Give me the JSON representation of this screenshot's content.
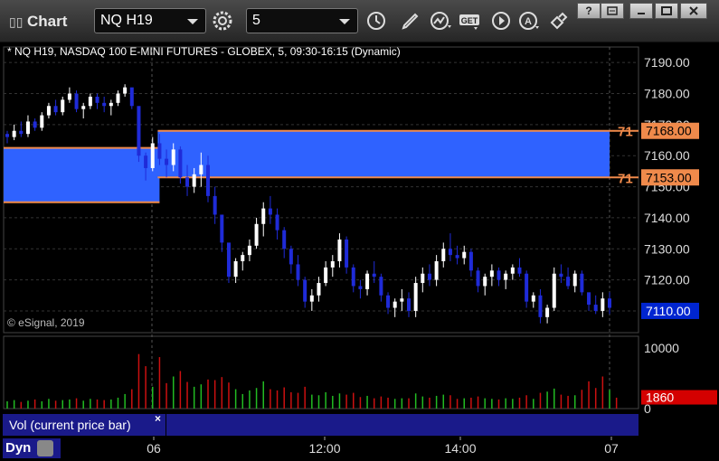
{
  "toolbar": {
    "title": "Chart",
    "symbol": "NQ H19",
    "interval": "5",
    "icons": [
      "settings-icon",
      "clock-icon",
      "pencil-icon",
      "studies-icon",
      "get-icon",
      "play-icon",
      "alert-icon",
      "link-icon"
    ],
    "window_buttons": [
      "help-icon",
      "restore-icon",
      "minimize-icon",
      "maximize-icon",
      "close-icon"
    ]
  },
  "chart_info": {
    "description": "* NQ H19, NASDAQ 100 E-MINI FUTURES - GLOBEX, 5, 09:30-16:15 (Dynamic)",
    "copyright": "© eSignal, 2019"
  },
  "price_axis": {
    "ticks": [
      "7190.00",
      "7180.00",
      "7170.00",
      "7160.00",
      "7150.00",
      "7140.00",
      "7130.00",
      "7120.00",
      "7110.00"
    ],
    "last_price": "7110.00",
    "upper_line_label": "7168.00",
    "lower_line_label": "7153.00",
    "upper_line_tag": "71",
    "lower_line_tag": "71"
  },
  "volume_axis": {
    "ticks": [
      "10000",
      "0"
    ],
    "last_volume": "1860"
  },
  "time_axis": {
    "ticks": [
      "06",
      "12:00",
      "14:00",
      "07"
    ]
  },
  "volume_panel": {
    "label": "Vol (current price bar)",
    "close": "×"
  },
  "footer": {
    "dyn_label": "Dyn"
  },
  "colors": {
    "up_candle": "#ffffff",
    "down_candle": "#1f2bd8",
    "zone_fill": "#2f62ff",
    "zone_border": "#f08a4b",
    "price_tag_blue": "#0025d0",
    "volume_tag_red": "#d40000",
    "volume_up": "#22bb22",
    "volume_down": "#cc1010"
  },
  "chart_data": {
    "type": "candlestick",
    "symbol": "NQ H19",
    "interval": "5",
    "ylim": [
      7103,
      7195
    ],
    "volume_ylim": [
      0,
      10000
    ],
    "zones": [
      {
        "top": 7162.5,
        "bottom": 7145.0,
        "from_bar": 0,
        "to_bar": 22
      },
      {
        "top": 7168.0,
        "bottom": 7153.0,
        "from_bar": 22,
        "to_bar": 96
      }
    ],
    "candles": [
      [
        7167,
        7168,
        7164,
        7166
      ],
      [
        7166,
        7170,
        7165,
        7168
      ],
      [
        7168,
        7171,
        7166,
        7167
      ],
      [
        7167,
        7173,
        7166,
        7171
      ],
      [
        7171,
        7172,
        7168,
        7169
      ],
      [
        7169,
        7174,
        7168,
        7173
      ],
      [
        7173,
        7177,
        7172,
        7176
      ],
      [
        7176,
        7178,
        7173,
        7174
      ],
      [
        7174,
        7179,
        7173,
        7178
      ],
      [
        7178,
        7182,
        7177,
        7180
      ],
      [
        7180,
        7181,
        7174,
        7175
      ],
      [
        7175,
        7177,
        7172,
        7176
      ],
      [
        7176,
        7180,
        7175,
        7179
      ],
      [
        7179,
        7180,
        7175,
        7177
      ],
      [
        7177,
        7179,
        7174,
        7176
      ],
      [
        7176,
        7178,
        7173,
        7177
      ],
      [
        7177,
        7181,
        7176,
        7180
      ],
      [
        7180,
        7183,
        7179,
        7182
      ],
      [
        7182,
        7181,
        7175,
        7176
      ],
      [
        7176,
        7175,
        7158,
        7160
      ],
      [
        7160,
        7161,
        7152,
        7156
      ],
      [
        7156,
        7166,
        7155,
        7164
      ],
      [
        7164,
        7167,
        7157,
        7159
      ],
      [
        7159,
        7162,
        7153,
        7157
      ],
      [
        7157,
        7164,
        7155,
        7162
      ],
      [
        7162,
        7163,
        7151,
        7153
      ],
      [
        7153,
        7157,
        7147,
        7150
      ],
      [
        7150,
        7156,
        7148,
        7154
      ],
      [
        7154,
        7161,
        7150,
        7157
      ],
      [
        7157,
        7160,
        7145,
        7147
      ],
      [
        7147,
        7150,
        7138,
        7141
      ],
      [
        7141,
        7140,
        7129,
        7132
      ],
      [
        7132,
        7130,
        7119,
        7121
      ],
      [
        7121,
        7127,
        7119,
        7126
      ],
      [
        7126,
        7129,
        7123,
        7128
      ],
      [
        7128,
        7133,
        7126,
        7131
      ],
      [
        7131,
        7140,
        7130,
        7138
      ],
      [
        7138,
        7145,
        7134,
        7143
      ],
      [
        7143,
        7147,
        7138,
        7141
      ],
      [
        7141,
        7143,
        7133,
        7136
      ],
      [
        7136,
        7137,
        7127,
        7130
      ],
      [
        7130,
        7131,
        7122,
        7125
      ],
      [
        7125,
        7128,
        7118,
        7120
      ],
      [
        7120,
        7121,
        7111,
        7113
      ],
      [
        7113,
        7117,
        7110,
        7115
      ],
      [
        7115,
        7121,
        7113,
        7119
      ],
      [
        7119,
        7126,
        7118,
        7124
      ],
      [
        7124,
        7128,
        7121,
        7126
      ],
      [
        7126,
        7135,
        7124,
        7133
      ],
      [
        7133,
        7134,
        7122,
        7124
      ],
      [
        7124,
        7125,
        7116,
        7118
      ],
      [
        7118,
        7120,
        7114,
        7117
      ],
      [
        7117,
        7123,
        7115,
        7122
      ],
      [
        7122,
        7126,
        7119,
        7121
      ],
      [
        7121,
        7122,
        7113,
        7115
      ],
      [
        7115,
        7116,
        7109,
        7111
      ],
      [
        7111,
        7114,
        7108,
        7113
      ],
      [
        7113,
        7117,
        7110,
        7114
      ],
      [
        7114,
        7116,
        7108,
        7110
      ],
      [
        7110,
        7121,
        7108,
        7119
      ],
      [
        7119,
        7124,
        7116,
        7122
      ],
      [
        7122,
        7125,
        7118,
        7120
      ],
      [
        7120,
        7128,
        7118,
        7126
      ],
      [
        7126,
        7132,
        7124,
        7130
      ],
      [
        7130,
        7135,
        7126,
        7128
      ],
      [
        7128,
        7131,
        7125,
        7127
      ],
      [
        7127,
        7131,
        7125,
        7129
      ],
      [
        7129,
        7130,
        7121,
        7123
      ],
      [
        7123,
        7124,
        7116,
        7118
      ],
      [
        7118,
        7122,
        7115,
        7121
      ],
      [
        7121,
        7125,
        7118,
        7123
      ],
      [
        7123,
        7124,
        7118,
        7120
      ],
      [
        7120,
        7123,
        7117,
        7122
      ],
      [
        7122,
        7125,
        7120,
        7124
      ],
      [
        7124,
        7127,
        7121,
        7122
      ],
      [
        7122,
        7123,
        7111,
        7113
      ],
      [
        7113,
        7116,
        7111,
        7115
      ],
      [
        7115,
        7117,
        7106,
        7108
      ],
      [
        7108,
        7112,
        7106,
        7111
      ],
      [
        7111,
        7124,
        7110,
        7122
      ],
      [
        7122,
        7125,
        7119,
        7121
      ],
      [
        7121,
        7124,
        7117,
        7118
      ],
      [
        7118,
        7123,
        7116,
        7122
      ],
      [
        7122,
        7123,
        7115,
        7116
      ],
      [
        7116,
        7115,
        7110,
        7112
      ],
      [
        7112,
        7115,
        7109,
        7110
      ],
      [
        7110,
        7116,
        7108,
        7114
      ],
      [
        7114,
        7116,
        7109,
        7111
      ]
    ],
    "volumes": [
      [
        1200,
        0
      ],
      [
        1400,
        0
      ],
      [
        1100,
        1
      ],
      [
        1300,
        0
      ],
      [
        1500,
        1
      ],
      [
        1200,
        0
      ],
      [
        1600,
        0
      ],
      [
        1300,
        1
      ],
      [
        1400,
        0
      ],
      [
        1500,
        0
      ],
      [
        1700,
        1
      ],
      [
        1300,
        0
      ],
      [
        1600,
        0
      ],
      [
        1500,
        1
      ],
      [
        1400,
        1
      ],
      [
        1500,
        0
      ],
      [
        1800,
        0
      ],
      [
        2400,
        0
      ],
      [
        3200,
        1
      ],
      [
        9000,
        1
      ],
      [
        7000,
        1
      ],
      [
        3600,
        0
      ],
      [
        8500,
        1
      ],
      [
        4200,
        1
      ],
      [
        5300,
        0
      ],
      [
        6200,
        1
      ],
      [
        4400,
        1
      ],
      [
        3600,
        0
      ],
      [
        4000,
        0
      ],
      [
        4800,
        1
      ],
      [
        4700,
        1
      ],
      [
        5200,
        1
      ],
      [
        4300,
        1
      ],
      [
        3200,
        0
      ],
      [
        2400,
        0
      ],
      [
        3000,
        0
      ],
      [
        3400,
        0
      ],
      [
        4500,
        0
      ],
      [
        3200,
        1
      ],
      [
        3000,
        1
      ],
      [
        3500,
        1
      ],
      [
        2700,
        1
      ],
      [
        2600,
        1
      ],
      [
        3600,
        1
      ],
      [
        2300,
        0
      ],
      [
        2200,
        0
      ],
      [
        2700,
        0
      ],
      [
        2100,
        0
      ],
      [
        2500,
        0
      ],
      [
        2300,
        1
      ],
      [
        2600,
        1
      ],
      [
        1900,
        1
      ],
      [
        2100,
        0
      ],
      [
        1700,
        1
      ],
      [
        2000,
        1
      ],
      [
        1800,
        1
      ],
      [
        1600,
        0
      ],
      [
        1700,
        0
      ],
      [
        1700,
        1
      ],
      [
        2500,
        0
      ],
      [
        2000,
        0
      ],
      [
        1800,
        1
      ],
      [
        2100,
        0
      ],
      [
        2300,
        0
      ],
      [
        2200,
        1
      ],
      [
        1600,
        1
      ],
      [
        1700,
        0
      ],
      [
        1800,
        1
      ],
      [
        2000,
        1
      ],
      [
        1700,
        0
      ],
      [
        1600,
        0
      ],
      [
        1500,
        1
      ],
      [
        1700,
        0
      ],
      [
        1600,
        0
      ],
      [
        1800,
        1
      ],
      [
        2200,
        1
      ],
      [
        1600,
        0
      ],
      [
        2600,
        1
      ],
      [
        2800,
        0
      ],
      [
        3300,
        0
      ],
      [
        2300,
        1
      ],
      [
        2100,
        1
      ],
      [
        2200,
        0
      ],
      [
        3100,
        1
      ],
      [
        4500,
        1
      ],
      [
        3400,
        1
      ],
      [
        5300,
        1
      ],
      [
        3100,
        0
      ],
      [
        1800,
        1
      ]
    ]
  }
}
